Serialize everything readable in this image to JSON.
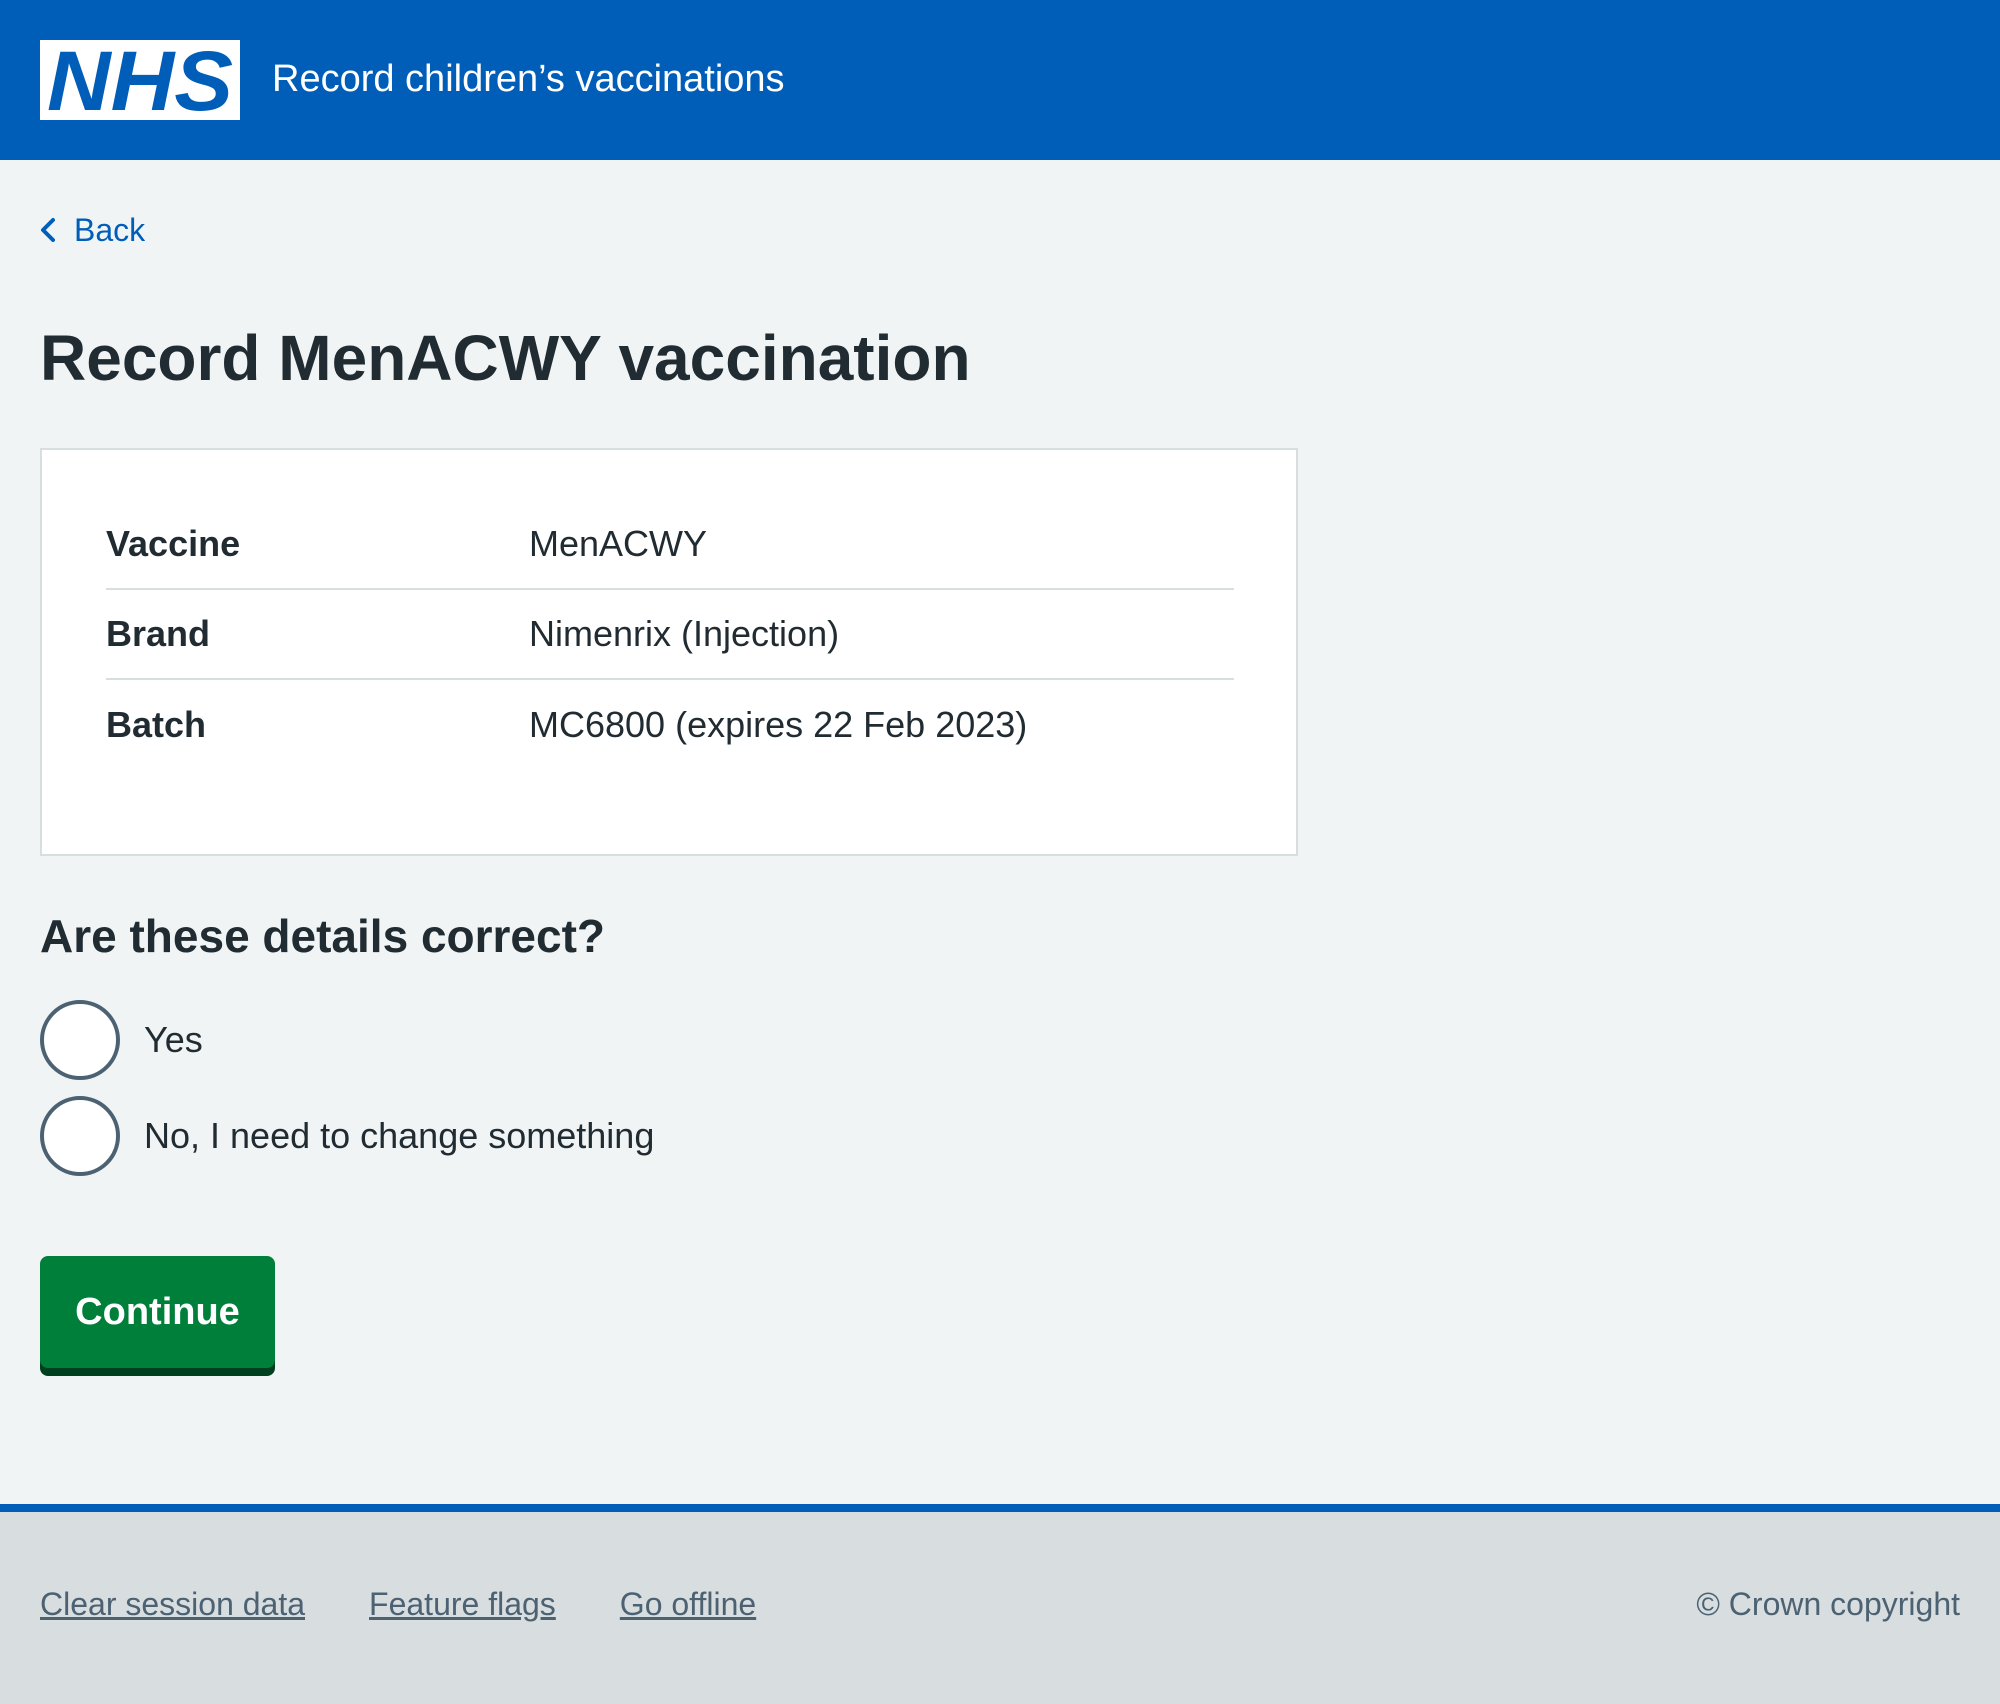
{
  "header": {
    "logo_text": "NHS",
    "service_name": "Record children’s vaccinations"
  },
  "back_link": {
    "label": "Back"
  },
  "page": {
    "title": "Record MenACWY vaccination"
  },
  "summary": {
    "rows": [
      {
        "key": "Vaccine",
        "value": "MenACWY"
      },
      {
        "key": "Brand",
        "value": "Nimenrix (Injection)"
      },
      {
        "key": "Batch",
        "value": "MC6800 (expires 22 Feb 2023)"
      }
    ]
  },
  "question": {
    "legend": "Are these details correct?",
    "options": [
      {
        "label": "Yes",
        "selected": false
      },
      {
        "label": "No, I need to change something",
        "selected": false
      }
    ]
  },
  "actions": {
    "continue_label": "Continue"
  },
  "footer": {
    "links": [
      "Clear session data",
      "Feature flags",
      "Go offline"
    ],
    "copyright": "© Crown copyright"
  },
  "colors": {
    "header_blue": "#005eb8",
    "page_background": "#f0f4f5",
    "button_green": "#007f3b",
    "text": "#212b32",
    "secondary_text": "#4c6272",
    "footer_background": "#d8dde0"
  }
}
